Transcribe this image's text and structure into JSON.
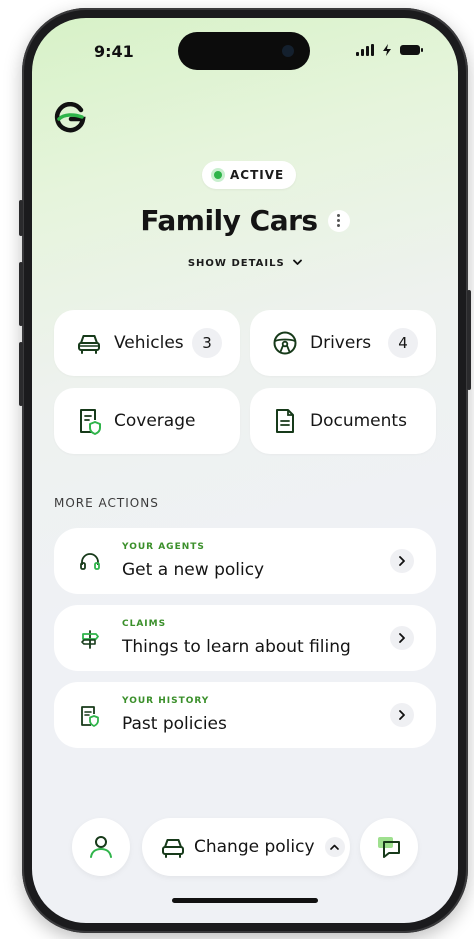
{
  "status_bar": {
    "time": "9:41"
  },
  "policy": {
    "status": "ACTIVE",
    "name": "Family Cars",
    "show_details": "SHOW DETAILS"
  },
  "cards": {
    "vehicles": {
      "label": "Vehicles",
      "count": "3"
    },
    "drivers": {
      "label": "Drivers",
      "count": "4"
    },
    "coverage": {
      "label": "Coverage"
    },
    "documents": {
      "label": "Documents"
    }
  },
  "more_actions": {
    "heading": "MORE ACTIONS",
    "items": [
      {
        "kicker": "YOUR AGENTS",
        "label": "Get a new policy",
        "icon": "headset-icon"
      },
      {
        "kicker": "CLAIMS",
        "label": "Things to learn about filing",
        "icon": "signpost-icon"
      },
      {
        "kicker": "YOUR HISTORY",
        "label": "Past policies",
        "icon": "document-shield-icon"
      }
    ]
  },
  "bottom_bar": {
    "change_policy": "Change policy"
  },
  "colors": {
    "accent": "#2fb44a",
    "kicker": "#3a8f2a",
    "background": "#eff1f5",
    "gradient_top": "#d7f2c7"
  }
}
